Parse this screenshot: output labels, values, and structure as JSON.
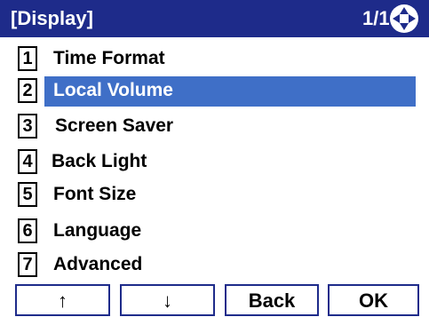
{
  "header": {
    "title": "[Display]",
    "page": "1/1",
    "nav_icon": "four-way-arrow-icon"
  },
  "menu": {
    "selected_index": 1,
    "items": [
      {
        "number": "1",
        "label": "Time Format"
      },
      {
        "number": "2",
        "label": "Local Volume"
      },
      {
        "number": "3",
        "label": "Screen Saver"
      },
      {
        "number": "4",
        "label": "Back Light"
      },
      {
        "number": "5",
        "label": "Font Size"
      },
      {
        "number": "6",
        "label": "Language"
      },
      {
        "number": "7",
        "label": "Advanced"
      }
    ]
  },
  "softkeys": {
    "up": "↑",
    "down": "↓",
    "back": "Back",
    "ok": "OK"
  },
  "colors": {
    "header_bg": "#1e2b8a",
    "selection": "#3f6fc7"
  }
}
